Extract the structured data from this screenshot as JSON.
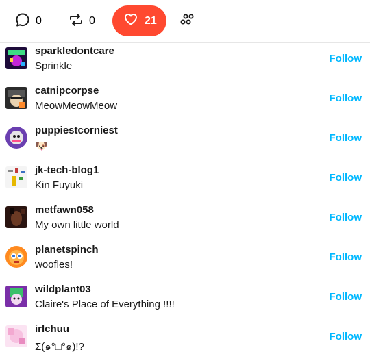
{
  "tabs": {
    "replies": {
      "count": "0",
      "icon": "speech-bubble-icon"
    },
    "reblogs": {
      "count": "0",
      "icon": "reblog-icon"
    },
    "likes": {
      "count": "21",
      "icon": "heart-icon",
      "bg": "#ff4930"
    },
    "more": {
      "icon": "community-icon"
    }
  },
  "follow_color": "#00b8ff",
  "users": [
    {
      "username": "sparkledontcare",
      "title": "Sprinkle",
      "follow_label": "Follow"
    },
    {
      "username": "catnipcorpse",
      "title": "MeowMeowMeow",
      "follow_label": "Follow"
    },
    {
      "username": "puppiestcorniest",
      "title": "🐶",
      "follow_label": "Follow"
    },
    {
      "username": "jk-tech-blog1",
      "title": "Kin Fuyuki",
      "follow_label": "Follow"
    },
    {
      "username": "metfawn058",
      "title": "My own little world",
      "follow_label": "Follow"
    },
    {
      "username": "planetspinch",
      "title": "woofles!",
      "follow_label": "Follow"
    },
    {
      "username": "wildplant03",
      "title": "Claire's Place of Everything !!!!",
      "follow_label": "Follow"
    },
    {
      "username": "irlchuu",
      "title": "Σ(๑°□°๑)!?",
      "follow_label": "Follow"
    }
  ]
}
